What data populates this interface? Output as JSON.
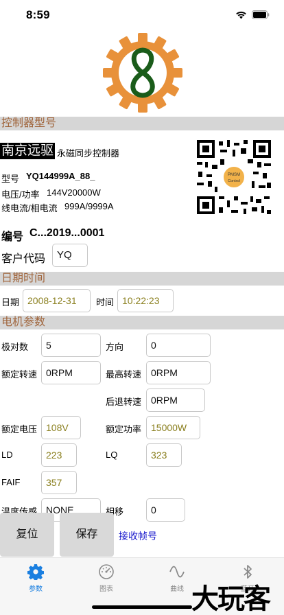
{
  "status": {
    "time": "8:59"
  },
  "model_section": {
    "title": "控制器型号",
    "brand": "南京远驱",
    "subtitle": "永磁同步控制器",
    "model_label": "型号",
    "model_value": "YQ144999A_88_",
    "voltage_label": "电压/功率",
    "voltage_value": "144V20000W",
    "current_label": "线电流/相电流",
    "current_value": "999A/9999A",
    "qr_badge_top": "PMSM",
    "qr_badge_bottom": "Control"
  },
  "serial": {
    "label": "编号",
    "value": "C...2019...0001"
  },
  "customer": {
    "label": "客户代码",
    "value": "YQ"
  },
  "datetime_section": {
    "title": "日期时间",
    "date_label": "日期",
    "date_value": "2008-12-31",
    "time_label": "时间",
    "time_value": "10:22:23"
  },
  "motor_section": {
    "title": "电机参数",
    "pole_pairs_label": "极对数",
    "pole_pairs_value": "5",
    "direction_label": "方向",
    "direction_value": "0",
    "rated_speed_label": "额定转速",
    "rated_speed_value": "0RPM",
    "max_speed_label": "最高转速",
    "max_speed_value": "0RPM",
    "reverse_speed_label": "后退转速",
    "reverse_speed_value": "0RPM",
    "rated_voltage_label": "额定电压",
    "rated_voltage_value": "108V",
    "rated_power_label": "额定功率",
    "rated_power_value": "15000W",
    "ld_label": "LD",
    "ld_value": "223",
    "lq_label": "LQ",
    "lq_value": "323",
    "faif_label": "FAIF",
    "faif_value": "357",
    "temp_sensor_label": "温度传感",
    "temp_sensor_value": "NONE",
    "phase_shift_label": "相移",
    "phase_shift_value": "0"
  },
  "actions": {
    "reset_label": "复位",
    "save_label": "保存",
    "receive_label": "接收帧号"
  },
  "tabs": [
    {
      "label": "参数",
      "icon": "gear-icon",
      "active": true
    },
    {
      "label": "图表",
      "icon": "gauge-icon",
      "active": false
    },
    {
      "label": "曲线",
      "icon": "wave-icon",
      "active": false
    },
    {
      "label": "蓝牙",
      "icon": "bluetooth-icon",
      "active": false
    }
  ],
  "watermark": "大玩客",
  "colors": {
    "accent": "#1a7fe0",
    "section_text": "#a0653c",
    "logo_gear": "#e8913a",
    "logo_eight": "#1a5c1a",
    "value_olive": "#8a7f1e"
  }
}
